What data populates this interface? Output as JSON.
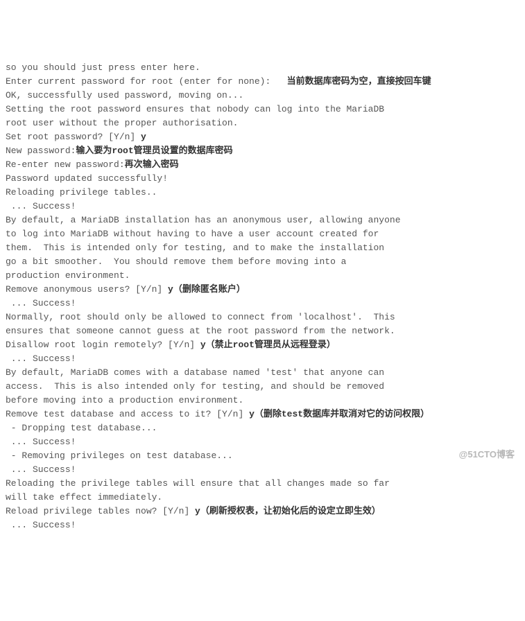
{
  "lines": [
    {
      "segments": [
        {
          "t": "so you should just press enter here."
        }
      ]
    },
    {
      "segments": [
        {
          "t": "Enter current password for root (enter for none):   "
        },
        {
          "t": "当前数据库密码为空，直接按回车键",
          "b": true
        }
      ]
    },
    {
      "segments": [
        {
          "t": "OK, successfully used password, moving on..."
        }
      ]
    },
    {
      "segments": [
        {
          "t": "Setting the root password ensures that nobody can log into the MariaDB"
        }
      ]
    },
    {
      "segments": [
        {
          "t": "root user without the proper authorisation."
        }
      ]
    },
    {
      "segments": [
        {
          "t": "Set root password? [Y/n] "
        },
        {
          "t": "y",
          "b": true
        }
      ]
    },
    {
      "segments": [
        {
          "t": "New password:"
        },
        {
          "t": "输入要为root管理员设置的数据库密码",
          "b": true
        }
      ]
    },
    {
      "segments": [
        {
          "t": "Re-enter new password:"
        },
        {
          "t": "再次输入密码",
          "b": true
        }
      ]
    },
    {
      "segments": [
        {
          "t": "Password updated successfully!"
        }
      ]
    },
    {
      "segments": [
        {
          "t": "Reloading privilege tables.."
        }
      ]
    },
    {
      "segments": [
        {
          "t": " ... Success!"
        }
      ]
    },
    {
      "segments": [
        {
          "t": "By default, a MariaDB installation has an anonymous user, allowing anyone"
        }
      ]
    },
    {
      "segments": [
        {
          "t": "to log into MariaDB without having to have a user account created for"
        }
      ]
    },
    {
      "segments": [
        {
          "t": "them.  This is intended only for testing, and to make the installation"
        }
      ]
    },
    {
      "segments": [
        {
          "t": "go a bit smoother.  You should remove them before moving into a"
        }
      ]
    },
    {
      "segments": [
        {
          "t": "production environment."
        }
      ]
    },
    {
      "segments": [
        {
          "t": "Remove anonymous users? [Y/n] "
        },
        {
          "t": "y（删除匿名账户）",
          "b": true
        }
      ]
    },
    {
      "segments": [
        {
          "t": " ... Success!"
        }
      ]
    },
    {
      "segments": [
        {
          "t": "Normally, root should only be allowed to connect from 'localhost'.  This"
        }
      ]
    },
    {
      "segments": [
        {
          "t": "ensures that someone cannot guess at the root password from the network."
        }
      ]
    },
    {
      "segments": [
        {
          "t": "Disallow root login remotely? [Y/n] "
        },
        {
          "t": "y（禁止root管理员从远程登录）",
          "b": true
        }
      ]
    },
    {
      "segments": [
        {
          "t": " ... Success!"
        }
      ]
    },
    {
      "segments": [
        {
          "t": "By default, MariaDB comes with a database named 'test' that anyone can"
        }
      ]
    },
    {
      "segments": [
        {
          "t": "access.  This is also intended only for testing, and should be removed"
        }
      ]
    },
    {
      "segments": [
        {
          "t": "before moving into a production environment."
        }
      ]
    },
    {
      "segments": [
        {
          "t": "Remove test database and access to it? [Y/n] "
        },
        {
          "t": "y（删除test数据库并取消对它的访问权限）",
          "b": true
        }
      ]
    },
    {
      "segments": [
        {
          "t": " - Dropping test database..."
        }
      ]
    },
    {
      "segments": [
        {
          "t": " ... Success!"
        }
      ]
    },
    {
      "segments": [
        {
          "t": " - Removing privileges on test database..."
        }
      ]
    },
    {
      "segments": [
        {
          "t": " ... Success!"
        }
      ]
    },
    {
      "segments": [
        {
          "t": "Reloading the privilege tables will ensure that all changes made so far"
        }
      ]
    },
    {
      "segments": [
        {
          "t": "will take effect immediately."
        }
      ]
    },
    {
      "segments": [
        {
          "t": "Reload privilege tables now? [Y/n] "
        },
        {
          "t": "y（刷新授权表，让初始化后的设定立即生效）",
          "b": true
        }
      ]
    },
    {
      "segments": [
        {
          "t": " ... Success!"
        }
      ]
    }
  ],
  "watermark": "@51CTO博客"
}
